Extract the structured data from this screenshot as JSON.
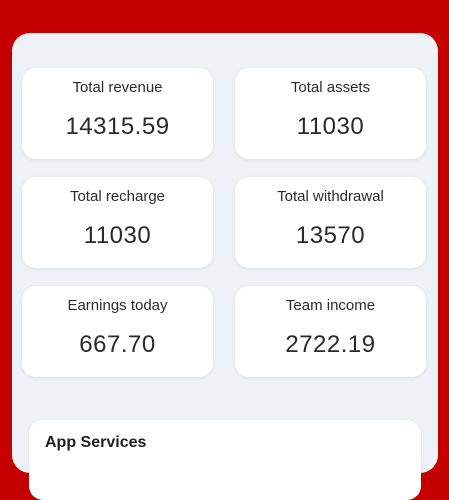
{
  "stats": [
    {
      "label": "Total revenue",
      "value": "14315.59"
    },
    {
      "label": "Total assets",
      "value": "11030"
    },
    {
      "label": "Total recharge",
      "value": "11030"
    },
    {
      "label": "Total withdrawal",
      "value": "13570"
    },
    {
      "label": "Earnings today",
      "value": "667.70"
    },
    {
      "label": "Team income",
      "value": "2722.19"
    }
  ],
  "services": {
    "title": "App Services"
  },
  "colors": {
    "header_bg": "#c40000",
    "panel_bg": "#eef2f6",
    "card_bg": "#ffffff"
  }
}
